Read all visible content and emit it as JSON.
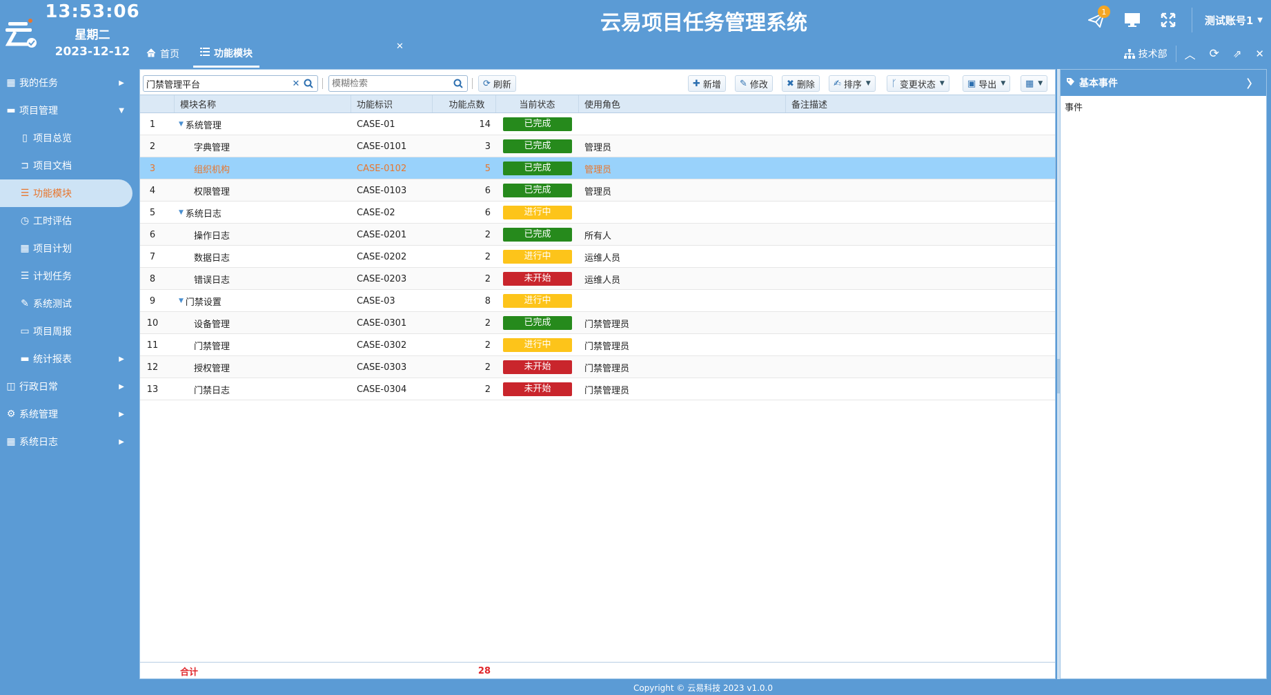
{
  "clock": {
    "time": "13:53:06",
    "weekday": "星期二",
    "date": "2023-12-12"
  },
  "app_title": "云易项目任务管理系统",
  "header": {
    "notification_count": "1",
    "account_name": "测试账号1"
  },
  "tabs": {
    "home": "首页",
    "module": "功能模块"
  },
  "tabbar_right": {
    "dept": "技术部"
  },
  "sidebar": {
    "my_tasks": "我的任务",
    "project_mgmt": "项目管理",
    "project_overview": "项目总览",
    "project_docs": "项目文档",
    "function_module": "功能模块",
    "hour_estimate": "工时评估",
    "project_plan": "项目计划",
    "plan_tasks": "计划任务",
    "system_test": "系统测试",
    "weekly_report": "项目周报",
    "stat_report": "统计报表",
    "admin_daily": "行政日常",
    "system_mgmt": "系统管理",
    "system_log": "系统日志"
  },
  "toolbar": {
    "project_value": "门禁管理平台",
    "search_placeholder": "模糊检索",
    "refresh": "刷新",
    "add": "新增",
    "edit": "修改",
    "delete": "删除",
    "sort": "排序",
    "change_status": "变更状态",
    "export": "导出"
  },
  "grid": {
    "headers": {
      "name": "模块名称",
      "code": "功能标识",
      "points": "功能点数",
      "status": "当前状态",
      "role": "使用角色",
      "remark": "备注描述"
    },
    "rows": [
      {
        "no": "1",
        "name": "系统管理",
        "code": "CASE-01",
        "points": "14",
        "status": "已完成",
        "role": "",
        "level": 0
      },
      {
        "no": "2",
        "name": "字典管理",
        "code": "CASE-0101",
        "points": "3",
        "status": "已完成",
        "role": "管理员",
        "level": 1
      },
      {
        "no": "3",
        "name": "组织机构",
        "code": "CASE-0102",
        "points": "5",
        "status": "已完成",
        "role": "管理员",
        "level": 1
      },
      {
        "no": "4",
        "name": "权限管理",
        "code": "CASE-0103",
        "points": "6",
        "status": "已完成",
        "role": "管理员",
        "level": 1
      },
      {
        "no": "5",
        "name": "系统日志",
        "code": "CASE-02",
        "points": "6",
        "status": "进行中",
        "role": "",
        "level": 0
      },
      {
        "no": "6",
        "name": "操作日志",
        "code": "CASE-0201",
        "points": "2",
        "status": "已完成",
        "role": "所有人",
        "level": 1
      },
      {
        "no": "7",
        "name": "数据日志",
        "code": "CASE-0202",
        "points": "2",
        "status": "进行中",
        "role": "运维人员",
        "level": 1
      },
      {
        "no": "8",
        "name": "错误日志",
        "code": "CASE-0203",
        "points": "2",
        "status": "未开始",
        "role": "运维人员",
        "level": 1
      },
      {
        "no": "9",
        "name": "门禁设置",
        "code": "CASE-03",
        "points": "8",
        "status": "进行中",
        "role": "",
        "level": 0
      },
      {
        "no": "10",
        "name": "设备管理",
        "code": "CASE-0301",
        "points": "2",
        "status": "已完成",
        "role": "门禁管理员",
        "level": 1
      },
      {
        "no": "11",
        "name": "门禁管理",
        "code": "CASE-0302",
        "points": "2",
        "status": "进行中",
        "role": "门禁管理员",
        "level": 1
      },
      {
        "no": "12",
        "name": "授权管理",
        "code": "CASE-0303",
        "points": "2",
        "status": "未开始",
        "role": "门禁管理员",
        "level": 1
      },
      {
        "no": "13",
        "name": "门禁日志",
        "code": "CASE-0304",
        "points": "2",
        "status": "未开始",
        "role": "门禁管理员",
        "level": 1
      }
    ],
    "selected_row": "3",
    "footer": {
      "label": "合计",
      "total_points": "28"
    }
  },
  "right_panel": {
    "title": "基本事件",
    "body": "事件"
  },
  "footer": "Copyright © 云易科技 2023 v1.0.0",
  "colors": {
    "primary": "#5b9bd5",
    "done": "#268a1c",
    "doing": "#fdc41a",
    "todo": "#c9252c",
    "selected": "#99d2fb",
    "accent": "#e8762d"
  }
}
